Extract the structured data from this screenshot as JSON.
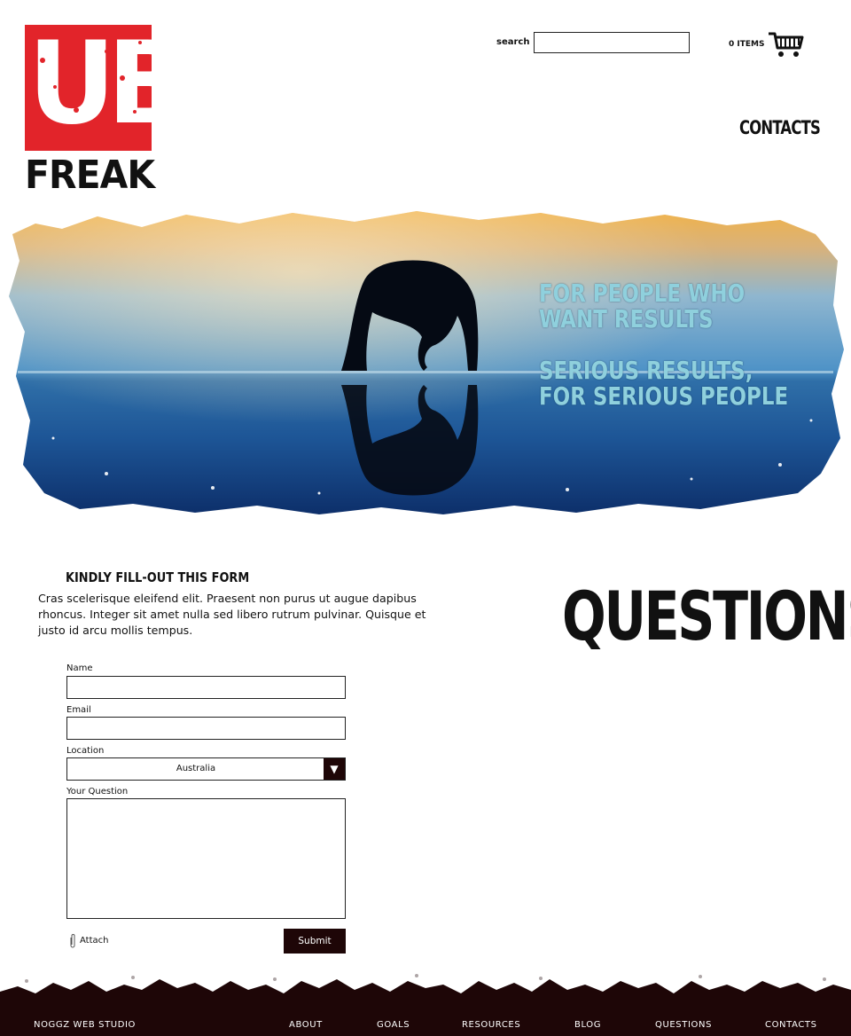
{
  "logo": {
    "mark": "UB",
    "word": "FREAK"
  },
  "header": {
    "search_label": "search",
    "cart_count": "0 ITEMS",
    "nav_contacts": "CONTACTS"
  },
  "hero": {
    "lines": [
      "FOR PEOPLE WHO",
      "WANT RESULTS",
      "SERIOUS RESULTS,",
      "FOR SERIOUS PEOPLE"
    ]
  },
  "intro": {
    "heading": "KINDLY FILL-OUT THIS FORM",
    "text": "Cras scelerisque eleifend elit. Praesent non purus ut augue dapibus rhoncus. Integer sit amet nulla sed libero rutrum pulvinar. Quisque et justo id arcu mollis tempus.",
    "title": "QUESTIONS"
  },
  "form": {
    "name_label": "Name",
    "email_label": "Email",
    "location_label": "Location",
    "location_value": "Australia",
    "question_label": "Your Question",
    "attach_label": "Attach",
    "submit_label": "Submit"
  },
  "footer": {
    "studio": "NOGGZ WEB STUDIO",
    "nav": [
      "ABOUT",
      "GOALS",
      "RESOURCES",
      "BLOG",
      "QUESTIONS",
      "CONTACTS"
    ]
  },
  "colors": {
    "brand_red": "#e2242a",
    "dark": "#1e0607",
    "hero_text": "#8fd0dd"
  },
  "icons": {
    "cart": "cart-icon",
    "paperclip": "paperclip-icon",
    "dropdown": "chevron-down-icon"
  }
}
